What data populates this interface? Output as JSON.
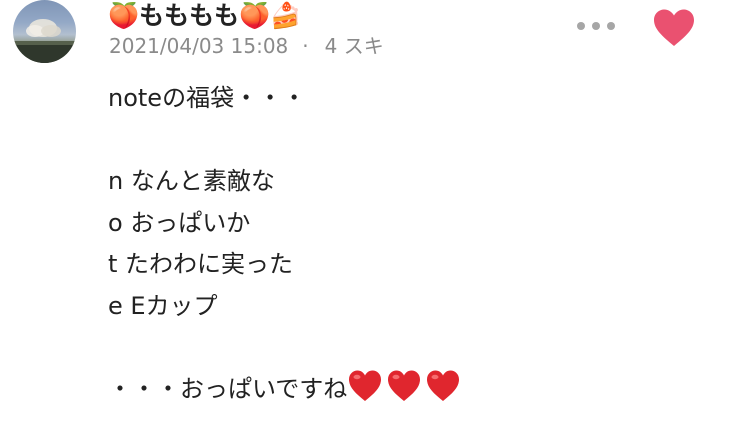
{
  "post": {
    "author": {
      "name": "🍑もももも🍑🍰"
    },
    "meta": {
      "timestamp": "2021/04/03 15:08",
      "separator": "·",
      "likes": "4 スキ"
    },
    "body_lines": [
      "noteの福袋・・・",
      "",
      "n なんと素敵な",
      "o おっぱいか",
      "t たわわに実った",
      "e Eカップ",
      "",
      "・・・おっぱいですね"
    ],
    "closing_hearts": 3,
    "colors": {
      "like_heart": "#ea5170",
      "inline_heart": "#e0262e",
      "meta_text": "#8a8a8a",
      "more_dots": "#a6a6a6"
    },
    "icons": {
      "more": "more-horizontal-icon",
      "like": "heart-icon",
      "inline": "red-heart-emoji"
    }
  }
}
